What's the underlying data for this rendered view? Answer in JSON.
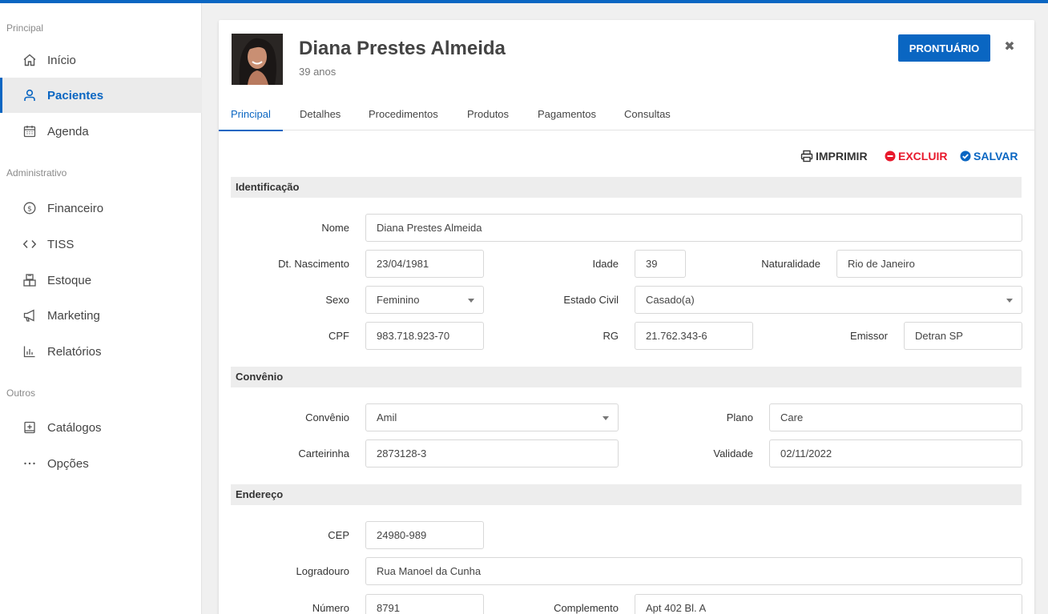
{
  "sidebar": {
    "sections": [
      {
        "title": "Principal",
        "items": [
          {
            "label": "Início",
            "icon": "home-icon"
          },
          {
            "label": "Pacientes",
            "icon": "user-icon",
            "active": true
          },
          {
            "label": "Agenda",
            "icon": "calendar-icon"
          }
        ]
      },
      {
        "title": "Administrativo",
        "items": [
          {
            "label": "Financeiro",
            "icon": "dollar-circle-icon"
          },
          {
            "label": "TISS",
            "icon": "code-icon"
          },
          {
            "label": "Estoque",
            "icon": "boxes-icon"
          },
          {
            "label": "Marketing",
            "icon": "megaphone-icon"
          },
          {
            "label": "Relatórios",
            "icon": "bar-chart-icon"
          }
        ]
      },
      {
        "title": "Outros",
        "items": [
          {
            "label": "Catálogos",
            "icon": "catalog-icon"
          },
          {
            "label": "Opções",
            "icon": "more-icon"
          }
        ]
      }
    ]
  },
  "patient": {
    "name": "Diana Prestes Almeida",
    "age": "39 anos"
  },
  "header": {
    "prontuario_label": "PRONTUÁRIO",
    "close_glyph": "✖"
  },
  "tabs": [
    "Principal",
    "Detalhes",
    "Procedimentos",
    "Produtos",
    "Pagamentos",
    "Consultas"
  ],
  "actions": {
    "print": "IMPRIMIR",
    "delete": "EXCLUIR",
    "save": "SALVAR"
  },
  "colors": {
    "accent": "#0a66c2",
    "danger": "#e8192c"
  },
  "identificacao": {
    "title": "Identificação",
    "nome_label": "Nome",
    "nome": "Diana Prestes Almeida",
    "nasc_label": "Dt. Nascimento",
    "nasc": "23/04/1981",
    "idade_label": "Idade",
    "idade": "39",
    "naturalidade_label": "Naturalidade",
    "naturalidade": "Rio de Janeiro",
    "sexo_label": "Sexo",
    "sexo": "Feminino",
    "estado_civil_label": "Estado Civil",
    "estado_civil": "Casado(a)",
    "cpf_label": "CPF",
    "cpf": "983.718.923-70",
    "rg_label": "RG",
    "rg": "21.762.343-6",
    "emissor_label": "Emissor",
    "emissor": "Detran SP"
  },
  "convenio": {
    "title": "Convênio",
    "convenio_label": "Convênio",
    "convenio": "Amil",
    "plano_label": "Plano",
    "plano": "Care",
    "carteirinha_label": "Carteirinha",
    "carteirinha": "2873128-3",
    "validade_label": "Validade",
    "validade": "02/11/2022"
  },
  "endereco": {
    "title": "Endereço",
    "cep_label": "CEP",
    "cep": "24980-989",
    "logradouro_label": "Logradouro",
    "logradouro": "Rua Manoel da Cunha",
    "numero_label": "Número",
    "numero": "8791",
    "complemento_label": "Complemento",
    "complemento": "Apt 402 Bl. A"
  }
}
